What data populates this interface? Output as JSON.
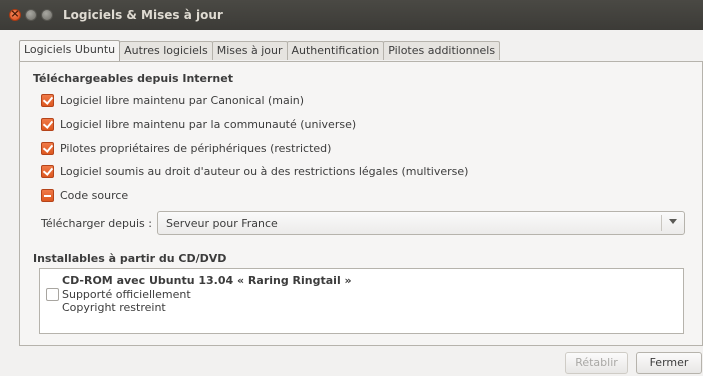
{
  "window": {
    "title": "Logiciels & Mises à jour"
  },
  "tabs": [
    {
      "label": "Logiciels Ubuntu",
      "active": true
    },
    {
      "label": "Autres logiciels",
      "active": false
    },
    {
      "label": "Mises à jour",
      "active": false
    },
    {
      "label": "Authentification",
      "active": false
    },
    {
      "label": "Pilotes additionnels",
      "active": false
    }
  ],
  "internet": {
    "title": "Téléchargeables depuis Internet",
    "sources": [
      {
        "label": "Logiciel libre maintenu par Canonical (main)",
        "state": "checked"
      },
      {
        "label": "Logiciel libre maintenu par la communauté (universe)",
        "state": "checked"
      },
      {
        "label": "Pilotes propriétaires de périphériques (restricted)",
        "state": "checked"
      },
      {
        "label": "Logiciel soumis au droit d'auteur ou à des restrictions légales (multiverse)",
        "state": "checked"
      },
      {
        "label": "Code source",
        "state": "mixed"
      }
    ],
    "download_from_label": "Télécharger depuis :",
    "download_from_value": "Serveur pour France"
  },
  "cdrom": {
    "title": "Installables à partir du CD/DVD",
    "item_title": "CD-ROM avec Ubuntu 13.04 « Raring Ringtail »",
    "item_line1": "Supporté officiellement",
    "item_line2": "Copyright restreint",
    "checked": false
  },
  "buttons": {
    "revert": "Rétablir",
    "close": "Fermer"
  },
  "colors": {
    "titlebar": "#3c3b37",
    "accent": "#dd5820",
    "background": "#f2f1f0"
  }
}
